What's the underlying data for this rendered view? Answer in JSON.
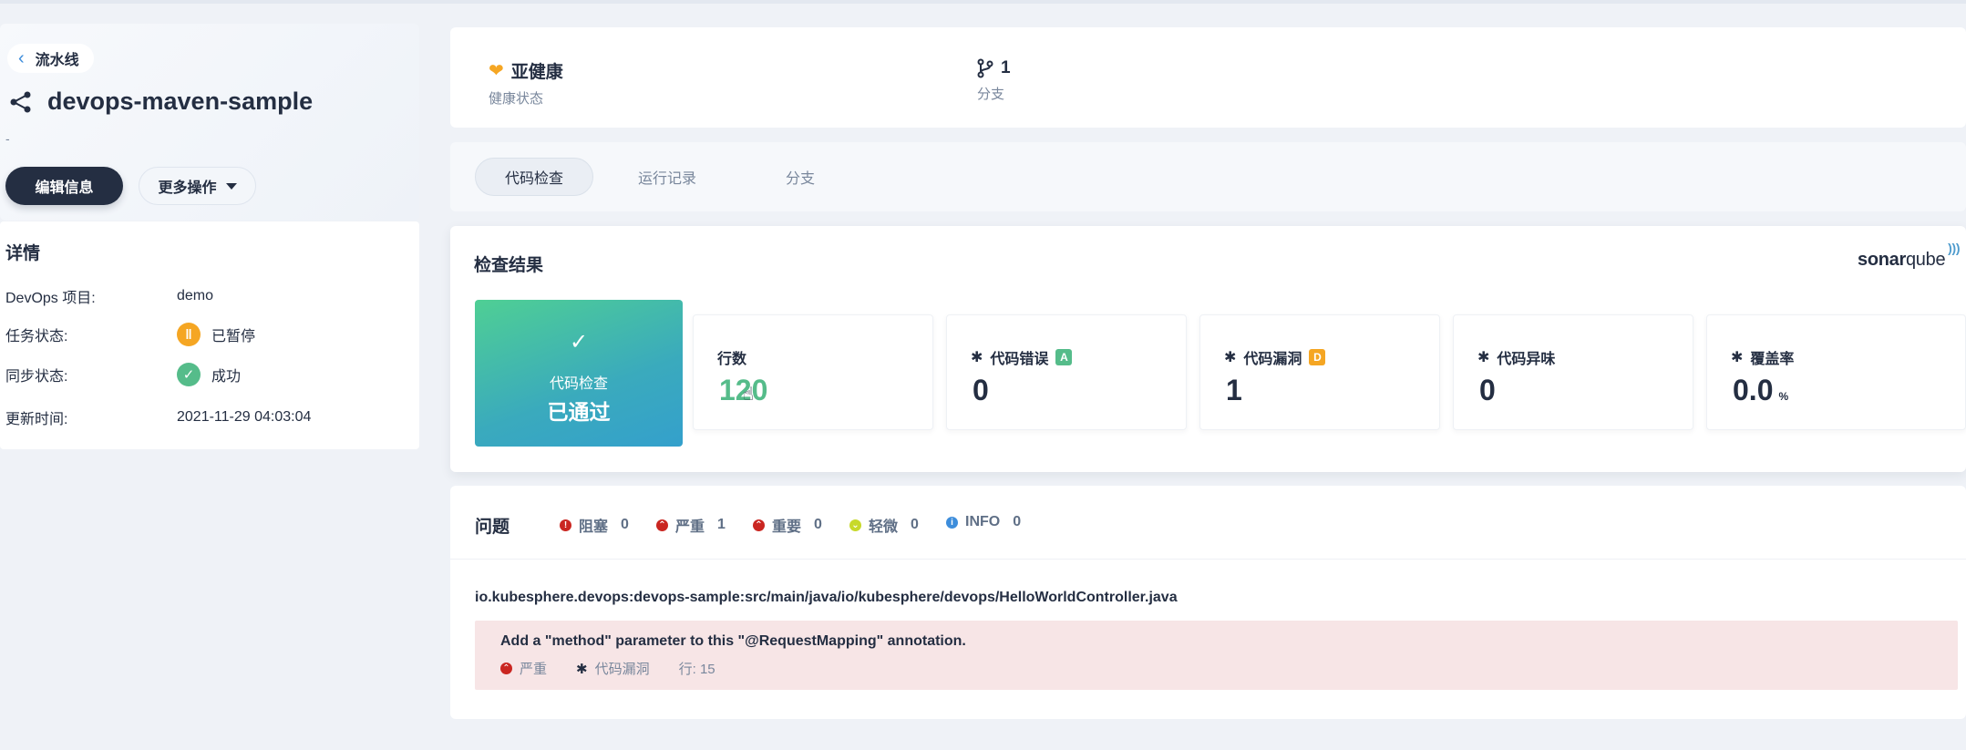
{
  "header": {
    "back_label": "流水线",
    "pipeline_name": "devops-maven-sample",
    "description": "-",
    "edit_button": "编辑信息",
    "more_button": "更多操作"
  },
  "details": {
    "title": "详情",
    "rows": [
      {
        "label": "DevOps 项目:",
        "value": "demo"
      },
      {
        "label": "任务状态:",
        "value": "已暂停"
      },
      {
        "label": "同步状态:",
        "value": "成功"
      },
      {
        "label": "更新时间:",
        "value": "2021-11-29 04:03:04"
      }
    ]
  },
  "status": {
    "health_value": "亚健康",
    "health_label": "健康状态",
    "branch_value": "1",
    "branch_label": "分支"
  },
  "tabs": [
    "代码检查",
    "运行记录",
    "分支"
  ],
  "active_tab": "代码检查",
  "results": {
    "title": "检查结果",
    "brand_a": "sonar",
    "brand_b": "qube",
    "pass_label": "代码检查",
    "pass_status": "已通过",
    "metrics": [
      {
        "label": "行数",
        "value": "120"
      },
      {
        "label": "代码错误",
        "grade": "A",
        "value": "0"
      },
      {
        "label": "代码漏洞",
        "grade": "D",
        "value": "1"
      },
      {
        "label": "代码异味",
        "value": "0"
      },
      {
        "label": "覆盖率",
        "value": "0.0",
        "unit": "%"
      }
    ]
  },
  "issues": {
    "title": "问题",
    "severities": [
      {
        "label": "阻塞",
        "count": "0",
        "color": "#ca2621"
      },
      {
        "label": "严重",
        "count": "1",
        "color": "#ca2621"
      },
      {
        "label": "重要",
        "count": "0",
        "color": "#ca2621"
      },
      {
        "label": "轻微",
        "count": "0",
        "color": "#c7d92a"
      },
      {
        "label": "INFO",
        "count": "0",
        "color": "#3d8ddb"
      }
    ],
    "file_path": "io.kubesphere.devops:devops-sample:src/main/java/io/kubesphere/devops/HelloWorldController.java",
    "items": [
      {
        "message": "Add a \"method\" parameter to this \"@RequestMapping\" annotation.",
        "severity": "严重",
        "type": "代码漏洞",
        "line": "行: 15"
      }
    ]
  }
}
